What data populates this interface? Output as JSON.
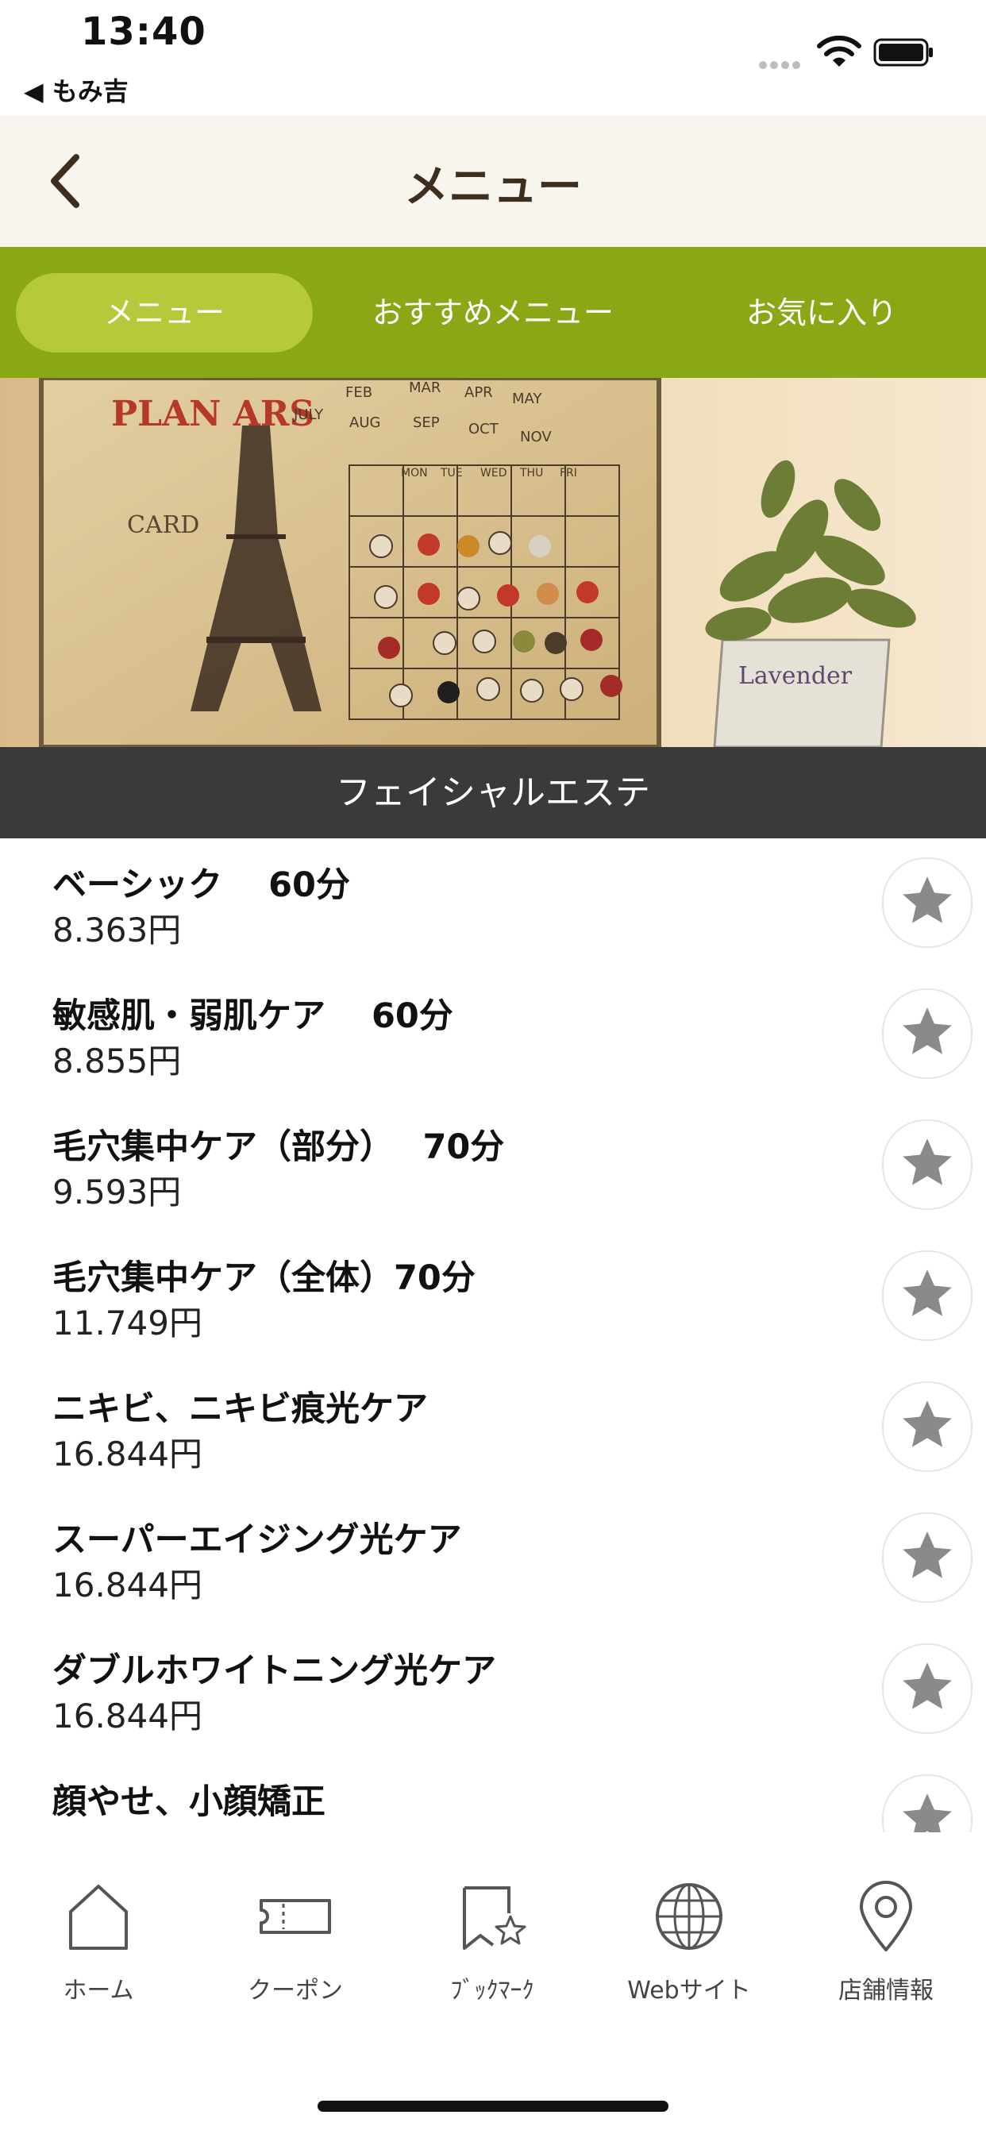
{
  "status_bar": {
    "time": "13:40",
    "back_app": "◀ もみ吉"
  },
  "header": {
    "title": "メニュー"
  },
  "tabs": [
    {
      "label": "メニュー",
      "active": true
    },
    {
      "label": "おすすめメニュー",
      "active": false
    },
    {
      "label": "お気に入り",
      "active": false
    }
  ],
  "banner": {
    "poster_text": "PLAN ARS",
    "card_text": "CARD",
    "pot_text": "Lavender",
    "calendar_months": [
      "FEB",
      "MAR",
      "APR",
      "MAY",
      "JULY",
      "AUG",
      "SEP",
      "OCT",
      "NOV"
    ],
    "calendar_days": [
      "MON",
      "TUE",
      "WED",
      "THU",
      "FRI"
    ]
  },
  "section": {
    "title": "フェイシャルエステ"
  },
  "menu_items": [
    {
      "name": "ベーシック　 60分",
      "price": "8.363円"
    },
    {
      "name": "敏感肌・弱肌ケア　 60分",
      "price": "8.855円"
    },
    {
      "name": "毛穴集中ケア（部分）　 70分",
      "price": "9.593円"
    },
    {
      "name": "毛穴集中ケア（全体）70分",
      "price": "11.749円"
    },
    {
      "name": "ニキビ、ニキビ痕光ケア",
      "price": "16.844円"
    },
    {
      "name": "スーパーエイジング光ケア",
      "price": "16.844円"
    },
    {
      "name": "ダブルホワイトニング光ケア",
      "price": "16.844円"
    },
    {
      "name": "顔やせ、小顔矯正",
      "price": ""
    }
  ],
  "bottom_nav": [
    {
      "label": "ホーム",
      "icon": "home-icon"
    },
    {
      "label": "クーポン",
      "icon": "coupon-icon"
    },
    {
      "label": "ﾌﾞｯｸﾏｰｸ",
      "icon": "bookmark-icon"
    },
    {
      "label": "Webサイト",
      "icon": "globe-icon"
    },
    {
      "label": "店舗情報",
      "icon": "map-pin-icon"
    }
  ],
  "colors": {
    "tab_bar": "#8aa716",
    "tab_active": "#b5c93a",
    "header_bg": "#f8f4ee",
    "section_bg": "#3a3a3a",
    "star": "#8a8a8a"
  }
}
